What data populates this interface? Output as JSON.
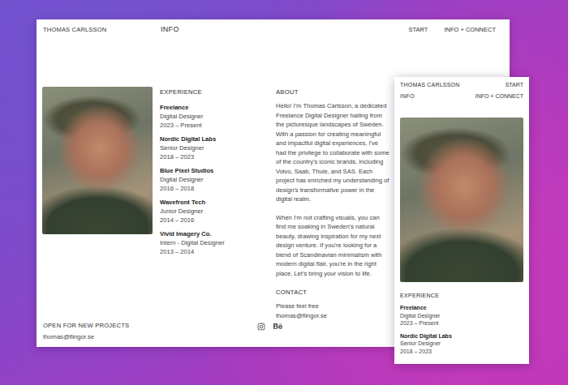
{
  "desktop": {
    "header": {
      "name": "THOMAS CARLSSON",
      "page": "INFO",
      "nav": [
        {
          "label": "START",
          "selected": false
        },
        {
          "label": "INFO + CONNECT",
          "selected": false
        }
      ]
    },
    "experience": {
      "heading": "EXPERIENCE",
      "items": [
        {
          "company": "Freelance",
          "role": "Digital Designer",
          "years": "2023 – Present"
        },
        {
          "company": "Nordic Digital Labs",
          "role": "Senior Designer",
          "years": "2018 – 2023"
        },
        {
          "company": "Blue Pixel Studios",
          "role": "Digital Designer",
          "years": "2016 – 2018"
        },
        {
          "company": "Wavefront Tech",
          "role": "Junior Designer",
          "years": "2014 – 2016"
        },
        {
          "company": "Vivid Imagery Co.",
          "role": "Intern - Digital Designer",
          "years": "2013 – 2014"
        }
      ]
    },
    "about": {
      "heading": "ABOUT",
      "paragraphs": [
        "Hello! I'm Thomas Carlsson, a dedicated Freelance Digital Designer hailing from the picturesque landscapes of Sweden. With a passion for creating meaningful and impactful digital experiences, I've had the privilege to collaborate with some of the country's iconic brands, including Volvo, Saab, Thule, and SAS. Each project has enriched my understanding of design's transformative power in the digital realm.",
        "When I'm not crafting visuals, you can find me soaking in Sweden's natural beauty, drawing inspiration for my next design venture. If you're looking for a blend of Scandinavian minimalism with modern digital flair, you're in the right place. Let's bring your vision to life."
      ]
    },
    "contact": {
      "heading": "CONTACT",
      "lines": [
        "Please feel free",
        "thomas@flingor.se"
      ]
    },
    "footer": {
      "status": "OPEN FOR NEW PROJECTS",
      "email": "thomas@flingor.se"
    }
  },
  "mobile": {
    "header": {
      "name": "THOMAS CARLSSON",
      "page": "INFO",
      "nav": [
        {
          "label": "START",
          "selected": false
        },
        {
          "label": "INFO + CONNECT",
          "selected": false
        }
      ]
    },
    "experience": {
      "heading": "EXPERIENCE",
      "items": [
        {
          "company": "Freelance",
          "role": "Digital Designer",
          "years": "2023 – Present"
        },
        {
          "company": "Nordic Digital Labs",
          "role": "Senior Designer",
          "years": "2018 – 2023"
        }
      ]
    }
  }
}
